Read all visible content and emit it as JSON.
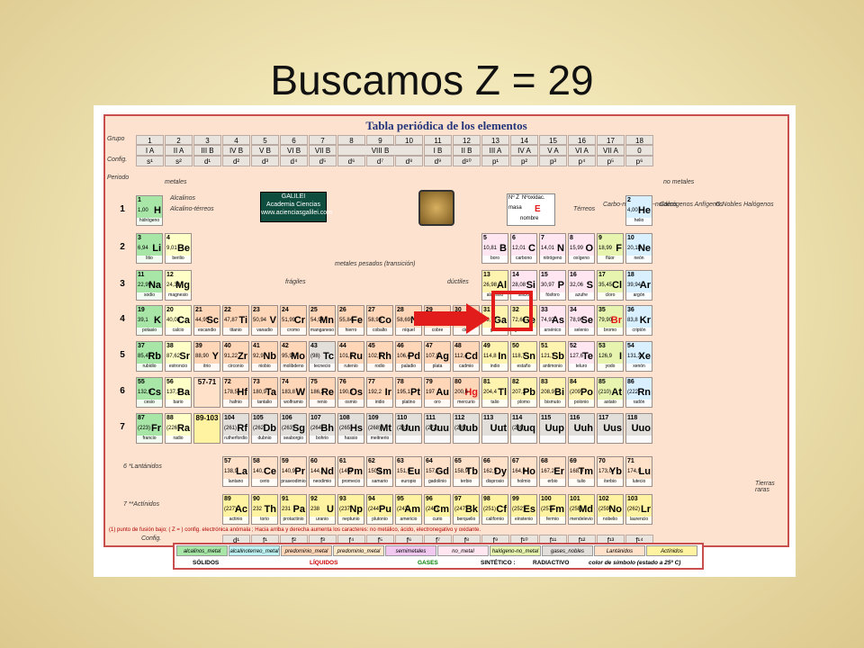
{
  "slide": {
    "title": "Buscamos Z = 29"
  },
  "table": {
    "title": "Tabla periódica de los elementos",
    "row_labels": {
      "grupo": "Grupo",
      "config": "Config.",
      "periodo": "Periodo"
    },
    "groups": [
      "1",
      "2",
      "3",
      "4",
      "5",
      "6",
      "7",
      "8",
      "9",
      "10",
      "11",
      "12",
      "13",
      "14",
      "15",
      "16",
      "17",
      "18"
    ],
    "groups_roman": [
      "I A",
      "II A",
      "III B",
      "IV B",
      "V B",
      "VI B",
      "VII B",
      "VIII B",
      "I B",
      "II B",
      "III A",
      "IV A",
      "V A",
      "VI A",
      "VII A",
      "0"
    ],
    "configs": [
      "s¹",
      "s²",
      "d¹",
      "d²",
      "d³",
      "d⁴",
      "d⁵",
      "d⁶",
      "d⁷",
      "d⁸",
      "d⁹",
      "d¹⁰",
      "p¹",
      "p²",
      "p³",
      "p⁴",
      "p⁵",
      "p⁶"
    ],
    "periods": [
      "1",
      "2",
      "3",
      "4",
      "5",
      "6",
      "7"
    ],
    "labels": {
      "metales": "metales",
      "no_metales": "no metales",
      "alcalinos": "Alcalinos",
      "alcalinoterreos": "Alcalino-térreos",
      "metales_pesados": "metales pesados (transición)",
      "fragiles": "frágiles",
      "ductiles": "dúctiles",
      "terreos": "Térreos",
      "carbonoideos": "Carbo-noideos",
      "nitrogenoideos": "Nitróge-noideos",
      "calcogenos": "Calcógenos Anfígenos",
      "halogenos": "G.Nobles Halógenos",
      "galilei_1": "GALILEI",
      "galilei_2": "Academia Ciencias",
      "galilei_3": "www.acienciasgalilei.com",
      "key_nz": "Nº Z",
      "key_ox": "Nºoxidac.",
      "key_masa": "masa",
      "key_e": "E",
      "key_nombre": "nombre",
      "lantanidos": "6 *Lantánidos",
      "actinidos": "7 **Actínidos",
      "tierras_raras": "Tierras raras",
      "footnote": "(1) punto de fusión bajo; ( Z = ) config. electrónica anómala ; Hacia arriba y derecha aumenta los caracteres: no metálico, ácido, electronegativo y oxidante.",
      "config_bottom": "Config.",
      "lan_ref": "57-71",
      "act_ref": "89-103"
    },
    "elements": [
      {
        "z": "1",
        "s": "H",
        "m": "1,00",
        "n": "hidrógeno",
        "c": "c-alk"
      },
      {
        "z": "2",
        "s": "He",
        "m": "4,00",
        "n": "helio",
        "c": "c-ng"
      },
      {
        "z": "3",
        "s": "Li",
        "m": "6,94",
        "n": "litio",
        "c": "c-alk"
      },
      {
        "z": "4",
        "s": "Be",
        "m": "9,01",
        "n": "berilio",
        "c": "c-ae"
      },
      {
        "z": "5",
        "s": "B",
        "m": "10,81",
        "n": "boro",
        "c": "c-ni"
      },
      {
        "z": "6",
        "s": "C",
        "m": "12,01",
        "n": "carbono",
        "c": "c-ni"
      },
      {
        "z": "7",
        "s": "N",
        "m": "14,01",
        "n": "nitrógeno",
        "c": "c-ni"
      },
      {
        "z": "8",
        "s": "O",
        "m": "15,99",
        "n": "oxígeno",
        "c": "c-ni"
      },
      {
        "z": "9",
        "s": "F",
        "m": "18,99",
        "n": "flúor",
        "c": "c-hal"
      },
      {
        "z": "10",
        "s": "Ne",
        "m": "20,18",
        "n": "neón",
        "c": "c-ng"
      },
      {
        "z": "11",
        "s": "Na",
        "m": "22,99",
        "n": "sodio",
        "c": "c-alk"
      },
      {
        "z": "12",
        "s": "Mg",
        "m": "24,30",
        "n": "magnesio",
        "c": "c-ae"
      },
      {
        "z": "13",
        "s": "Al",
        "m": "26,98",
        "n": "aluminio",
        "c": "c-pm"
      },
      {
        "z": "14",
        "s": "Si",
        "m": "28,08",
        "n": "silicio",
        "c": "c-ni"
      },
      {
        "z": "15",
        "s": "P",
        "m": "30,97",
        "n": "fósforo",
        "c": "c-ni"
      },
      {
        "z": "16",
        "s": "S",
        "m": "32,06",
        "n": "azufre",
        "c": "c-ni"
      },
      {
        "z": "17",
        "s": "Cl",
        "m": "35,45",
        "n": "cloro",
        "c": "c-hal"
      },
      {
        "z": "18",
        "s": "Ar",
        "m": "39,94",
        "n": "argón",
        "c": "c-ng"
      },
      {
        "z": "19",
        "s": "K",
        "m": "39,1",
        "n": "potasio",
        "c": "c-alk"
      },
      {
        "z": "20",
        "s": "Ca",
        "m": "40,08",
        "n": "calcio",
        "c": "c-ae"
      },
      {
        "z": "21",
        "s": "Sc",
        "m": "44,95",
        "n": "escandio",
        "c": "c-tr"
      },
      {
        "z": "22",
        "s": "Ti",
        "m": "47,87",
        "n": "titanio",
        "c": "c-tr"
      },
      {
        "z": "23",
        "s": "V",
        "m": "50,94",
        "n": "vanadio",
        "c": "c-tr"
      },
      {
        "z": "24",
        "s": "Cr",
        "m": "51,99",
        "n": "cromo",
        "c": "c-tr"
      },
      {
        "z": "25",
        "s": "Mn",
        "m": "54,94",
        "n": "manganeso",
        "c": "c-tr"
      },
      {
        "z": "26",
        "s": "Fe",
        "m": "55,84",
        "n": "hierro",
        "c": "c-tr"
      },
      {
        "z": "27",
        "s": "Co",
        "m": "58,93",
        "n": "cobalto",
        "c": "c-tr"
      },
      {
        "z": "28",
        "s": "Ni",
        "m": "58,69",
        "n": "níquel",
        "c": "c-tr"
      },
      {
        "z": "29",
        "s": "Cu",
        "m": "63,54",
        "n": "cobre",
        "c": "c-tr"
      },
      {
        "z": "30",
        "s": "Zn",
        "m": "65,41",
        "n": "cinc",
        "c": "c-tr"
      },
      {
        "z": "31",
        "s": "Ga",
        "m": "69,72",
        "n": "galio",
        "c": "c-pm"
      },
      {
        "z": "32",
        "s": "Ge",
        "m": "72,64",
        "n": "germanio",
        "c": "c-pm"
      },
      {
        "z": "33",
        "s": "As",
        "m": "74,92",
        "n": "arsénico",
        "c": "c-ni"
      },
      {
        "z": "34",
        "s": "Se",
        "m": "78,96",
        "n": "selenio",
        "c": "c-ni"
      },
      {
        "z": "35",
        "s": "Br",
        "m": "79,90",
        "n": "bromo",
        "c": "c-hal"
      },
      {
        "z": "36",
        "s": "Kr",
        "m": "83,8",
        "n": "criptón",
        "c": "c-ng"
      },
      {
        "z": "37",
        "s": "Rb",
        "m": "85,47",
        "n": "rubidio",
        "c": "c-alk"
      },
      {
        "z": "38",
        "s": "Sr",
        "m": "87,62",
        "n": "estroncio",
        "c": "c-ae"
      },
      {
        "z": "39",
        "s": "Y",
        "m": "88,90",
        "n": "itrio",
        "c": "c-tr"
      },
      {
        "z": "40",
        "s": "Zr",
        "m": "91,22",
        "n": "circonio",
        "c": "c-tr"
      },
      {
        "z": "41",
        "s": "Nb",
        "m": "92,9",
        "n": "niobio",
        "c": "c-tr"
      },
      {
        "z": "42",
        "s": "Mo",
        "m": "95,94",
        "n": "molibdeno",
        "c": "c-tr"
      },
      {
        "z": "43",
        "s": "Tc",
        "m": "(98)",
        "n": "tecnecio",
        "c": "c-syn"
      },
      {
        "z": "44",
        "s": "Ru",
        "m": "101,0",
        "n": "rutenio",
        "c": "c-tr"
      },
      {
        "z": "45",
        "s": "Rh",
        "m": "102,9",
        "n": "rodio",
        "c": "c-tr"
      },
      {
        "z": "46",
        "s": "Pd",
        "m": "106,4",
        "n": "paladio",
        "c": "c-tr"
      },
      {
        "z": "47",
        "s": "Ag",
        "m": "107,8",
        "n": "plata",
        "c": "c-tr"
      },
      {
        "z": "48",
        "s": "Cd",
        "m": "112,4",
        "n": "cadmio",
        "c": "c-tr"
      },
      {
        "z": "49",
        "s": "In",
        "m": "114,8",
        "n": "indio",
        "c": "c-pm"
      },
      {
        "z": "50",
        "s": "Sn",
        "m": "118,7",
        "n": "estaño",
        "c": "c-pm"
      },
      {
        "z": "51",
        "s": "Sb",
        "m": "121,7",
        "n": "antimonio",
        "c": "c-pm"
      },
      {
        "z": "52",
        "s": "Te",
        "m": "127,6",
        "n": "teluro",
        "c": "c-ni"
      },
      {
        "z": "53",
        "s": "I",
        "m": "126,9",
        "n": "yodo",
        "c": "c-hal"
      },
      {
        "z": "54",
        "s": "Xe",
        "m": "131,3",
        "n": "xenón",
        "c": "c-ng"
      },
      {
        "z": "55",
        "s": "Cs",
        "m": "132,9",
        "n": "cesio",
        "c": "c-alk"
      },
      {
        "z": "56",
        "s": "Ba",
        "m": "137,3",
        "n": "bario",
        "c": "c-ae"
      },
      {
        "z": "72",
        "s": "Hf",
        "m": "178,5",
        "n": "hafnio",
        "c": "c-tr"
      },
      {
        "z": "73",
        "s": "Ta",
        "m": "180,9",
        "n": "tantalio",
        "c": "c-tr"
      },
      {
        "z": "74",
        "s": "W",
        "m": "183,8",
        "n": "wolframio",
        "c": "c-tr"
      },
      {
        "z": "75",
        "s": "Re",
        "m": "186,2",
        "n": "renio",
        "c": "c-tr"
      },
      {
        "z": "76",
        "s": "Os",
        "m": "190,2",
        "n": "osmio",
        "c": "c-tr"
      },
      {
        "z": "77",
        "s": "Ir",
        "m": "192,2",
        "n": "iridio",
        "c": "c-tr"
      },
      {
        "z": "78",
        "s": "Pt",
        "m": "195,1",
        "n": "platino",
        "c": "c-tr"
      },
      {
        "z": "79",
        "s": "Au",
        "m": "197",
        "n": "oro",
        "c": "c-tr"
      },
      {
        "z": "80",
        "s": "Hg",
        "m": "200,6",
        "n": "mercurio",
        "c": "c-tr"
      },
      {
        "z": "81",
        "s": "Tl",
        "m": "204,4",
        "n": "talio",
        "c": "c-pm"
      },
      {
        "z": "82",
        "s": "Pb",
        "m": "207,2",
        "n": "plomo",
        "c": "c-pm"
      },
      {
        "z": "83",
        "s": "Bi",
        "m": "208,9",
        "n": "bismuto",
        "c": "c-pm"
      },
      {
        "z": "84",
        "s": "Po",
        "m": "(209)",
        "n": "polonio",
        "c": "c-pm"
      },
      {
        "z": "85",
        "s": "At",
        "m": "(210)",
        "n": "astato",
        "c": "c-hal"
      },
      {
        "z": "86",
        "s": "Rn",
        "m": "(222)",
        "n": "radón",
        "c": "c-ng"
      },
      {
        "z": "87",
        "s": "Fr",
        "m": "(223)",
        "n": "francio",
        "c": "c-alk"
      },
      {
        "z": "88",
        "s": "Ra",
        "m": "(226)",
        "n": "radio",
        "c": "c-ae"
      },
      {
        "z": "104",
        "s": "Rf",
        "m": "(261)",
        "n": "rutherfordio",
        "c": "c-syn"
      },
      {
        "z": "105",
        "s": "Db",
        "m": "(262)",
        "n": "dubnio",
        "c": "c-syn"
      },
      {
        "z": "106",
        "s": "Sg",
        "m": "(263)",
        "n": "seaborgio",
        "c": "c-syn"
      },
      {
        "z": "107",
        "s": "Bh",
        "m": "(264)",
        "n": "bohrio",
        "c": "c-syn"
      },
      {
        "z": "108",
        "s": "Hs",
        "m": "(265)",
        "n": "hassio",
        "c": "c-syn"
      },
      {
        "z": "109",
        "s": "Mt",
        "m": "(268)",
        "n": "meitnerio",
        "c": "c-syn"
      },
      {
        "z": "110",
        "s": "Uun",
        "m": "(281)",
        "n": "",
        "c": "c-syn"
      },
      {
        "z": "111",
        "s": "Uuu",
        "m": "(272)",
        "n": "",
        "c": "c-syn"
      },
      {
        "z": "112",
        "s": "Uub",
        "m": "(285)",
        "n": "",
        "c": "c-syn"
      },
      {
        "z": "113",
        "s": "Uut",
        "m": "",
        "n": "",
        "c": "c-syn"
      },
      {
        "z": "114",
        "s": "Uuq",
        "m": "(289)",
        "n": "",
        "c": "c-syn"
      },
      {
        "z": "115",
        "s": "Uup",
        "m": "",
        "n": "",
        "c": "c-syn"
      },
      {
        "z": "116",
        "s": "Uuh",
        "m": "",
        "n": "",
        "c": "c-syn"
      },
      {
        "z": "117",
        "s": "Uus",
        "m": "",
        "n": "",
        "c": "c-syn"
      },
      {
        "z": "118",
        "s": "Uuo",
        "m": "",
        "n": "",
        "c": "c-syn"
      }
    ],
    "lanthanides": [
      {
        "z": "57",
        "s": "La",
        "m": "138,9",
        "n": "lantano"
      },
      {
        "z": "58",
        "s": "Ce",
        "m": "140,1",
        "n": "cerio"
      },
      {
        "z": "59",
        "s": "Pr",
        "m": "140,9",
        "n": "praseodimio"
      },
      {
        "z": "60",
        "s": "Nd",
        "m": "144,2",
        "n": "neodimio"
      },
      {
        "z": "61",
        "s": "Pm",
        "m": "(145)",
        "n": "promecio"
      },
      {
        "z": "62",
        "s": "Sm",
        "m": "150,3",
        "n": "samario"
      },
      {
        "z": "63",
        "s": "Eu",
        "m": "151,9",
        "n": "europio"
      },
      {
        "z": "64",
        "s": "Gd",
        "m": "157,2",
        "n": "gadolinio"
      },
      {
        "z": "65",
        "s": "Tb",
        "m": "158,9",
        "n": "terbio"
      },
      {
        "z": "66",
        "s": "Dy",
        "m": "162,5",
        "n": "disprosio"
      },
      {
        "z": "67",
        "s": "Ho",
        "m": "164,9",
        "n": "holmio"
      },
      {
        "z": "68",
        "s": "Er",
        "m": "167,2",
        "n": "erbio"
      },
      {
        "z": "69",
        "s": "Tm",
        "m": "168,9",
        "n": "tulio"
      },
      {
        "z": "70",
        "s": "Yb",
        "m": "173,0",
        "n": "iterbio"
      },
      {
        "z": "71",
        "s": "Lu",
        "m": "174,9",
        "n": "lutecio"
      }
    ],
    "actinides": [
      {
        "z": "89",
        "s": "Ac",
        "m": "(227)",
        "n": "actinio"
      },
      {
        "z": "90",
        "s": "Th",
        "m": "232",
        "n": "torio"
      },
      {
        "z": "91",
        "s": "Pa",
        "m": "231",
        "n": "protactinio"
      },
      {
        "z": "92",
        "s": "U",
        "m": "238",
        "n": "uranio"
      },
      {
        "z": "93",
        "s": "Np",
        "m": "(237)",
        "n": "neptunio"
      },
      {
        "z": "94",
        "s": "Pu",
        "m": "(244)",
        "n": "plutonio"
      },
      {
        "z": "95",
        "s": "Am",
        "m": "(243)",
        "n": "americio"
      },
      {
        "z": "96",
        "s": "Cm",
        "m": "(247)",
        "n": "curio"
      },
      {
        "z": "97",
        "s": "Bk",
        "m": "(247)",
        "n": "berquelio"
      },
      {
        "z": "98",
        "s": "Cf",
        "m": "(251)",
        "n": "californio"
      },
      {
        "z": "99",
        "s": "Es",
        "m": "(252)",
        "n": "einstenio"
      },
      {
        "z": "100",
        "s": "Fm",
        "m": "(257)",
        "n": "fermio"
      },
      {
        "z": "101",
        "s": "Md",
        "m": "(258)",
        "n": "mendelevio"
      },
      {
        "z": "102",
        "s": "No",
        "m": "(259)",
        "n": "nobelio"
      },
      {
        "z": "103",
        "s": "Lr",
        "m": "(262)",
        "n": "laurencio"
      }
    ],
    "bottom_config": [
      "d¹",
      "f¹",
      "f²",
      "f³",
      "f⁴",
      "f⁵",
      "f⁶",
      "f⁷",
      "f⁸",
      "f⁹",
      "f¹⁰",
      "f¹¹",
      "f¹²",
      "f¹³",
      "f¹⁴"
    ],
    "legend": {
      "row1": [
        "alcalinos_metal",
        "alcalinoterreo_metal",
        "predominio_metal",
        "predominio_metal",
        "semimetales",
        "no_metal",
        "halógeno-no_metal",
        "gases_nobles",
        "Lantánidos",
        "Actínidos"
      ],
      "solidos": "SÓLIDOS",
      "liquidos": "LÍQUIDOS",
      "gases": "GASES",
      "sintetico": "SINTÉTICO :",
      "radiactivo": "RADIACTIVO",
      "color_simbolo": "color de símbolo (estado a 25º C)"
    }
  },
  "colors": {
    "highlight": "#e21b1b",
    "frame": "#c94f4f",
    "title_blue": "#23347a"
  }
}
